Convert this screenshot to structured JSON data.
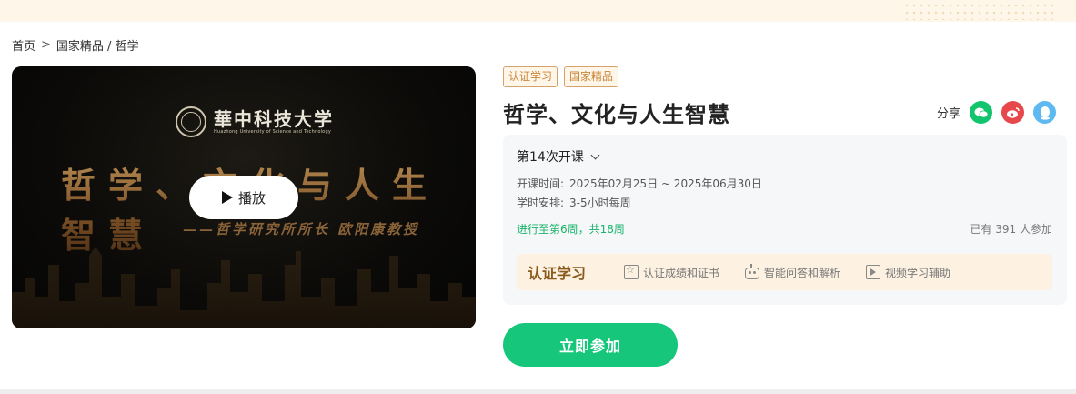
{
  "breadcrumb": {
    "home": "首页",
    "separator": ">",
    "path": "国家精品 / 哲学"
  },
  "video": {
    "university_cn": "華中科技大学",
    "university_en": "Huazhong University of Science and Technology",
    "main_title": "哲学、文化与人生智慧",
    "subtitle": "——哲学研究所所长 欧阳康教授",
    "play_label": "播放",
    "play_icon": "play-icon"
  },
  "tags": [
    "认证学习",
    "国家精品"
  ],
  "course": {
    "title": "哲学、文化与人生智慧"
  },
  "share": {
    "label": "分享",
    "icons": [
      "wechat-icon",
      "weibo-icon",
      "qq-icon"
    ]
  },
  "session": {
    "label": "第14次开课",
    "time_label": "开课时间:",
    "time_value": "2025年02月25日 ~ 2025年06月30日",
    "schedule_label": "学时安排:",
    "schedule_value": "3-5小时每周",
    "progress": "进行至第6周，共18周",
    "participants": "已有 391 人参加"
  },
  "certification": {
    "title": "认证学习",
    "features": [
      {
        "label": "认证成绩和证书",
        "icon": "certificate-icon"
      },
      {
        "label": "智能问答和解析",
        "icon": "robot-icon"
      },
      {
        "label": "视频学习辅助",
        "icon": "video-icon"
      }
    ]
  },
  "join_button": "立即参加",
  "colors": {
    "accent_green": "#15c67b",
    "tag_orange": "#c8873a",
    "cert_brown": "#8a5a1c"
  }
}
